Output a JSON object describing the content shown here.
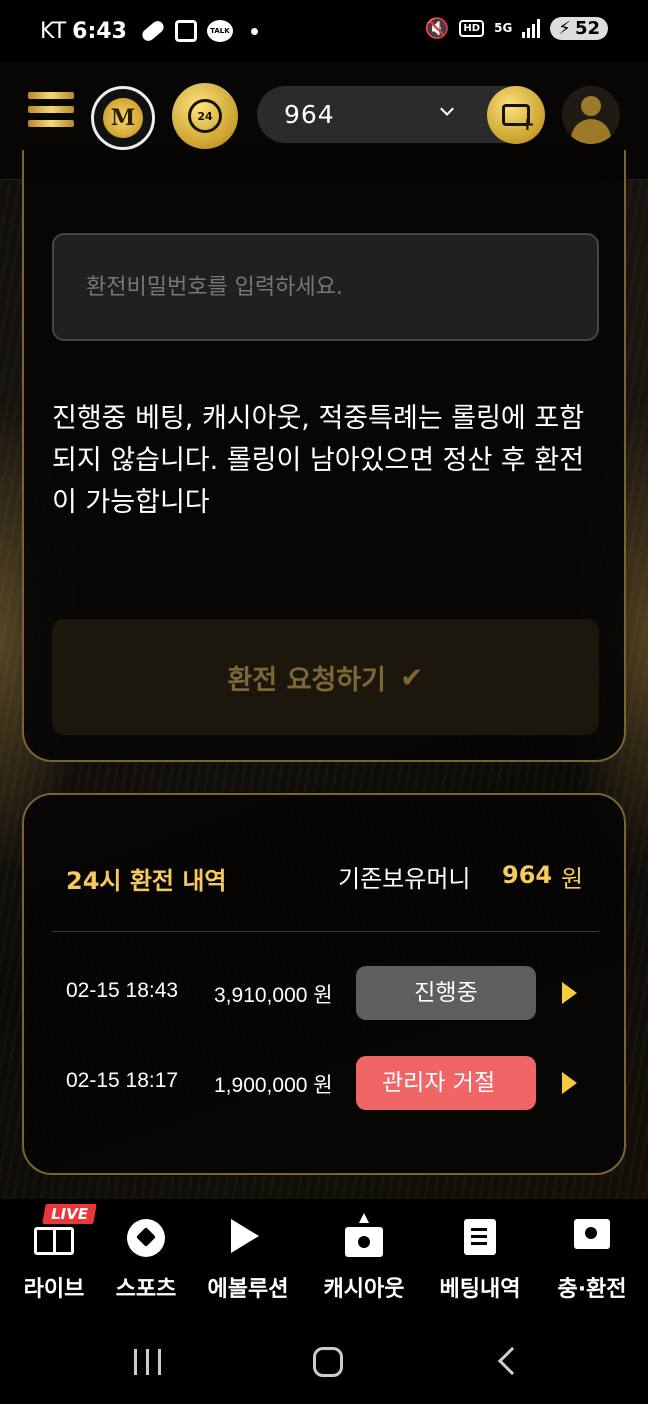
{
  "status_bar": {
    "carrier": "KT",
    "time": "6:43",
    "talk_label": "TALK",
    "hd_label": "HD",
    "network_label": "5G",
    "battery": "52"
  },
  "header": {
    "logo_letter": "M",
    "support_label": "24",
    "balance": "964"
  },
  "withdraw_form": {
    "password_placeholder": "환전비밀번호를 입력하세요.",
    "notice": "진행중 베팅, 캐시아웃, 적중특례는 롤링에 포함되지 않습니다. 롤링이 남아있으면 정산 후 환전이 가능합니다",
    "request_button_label": "환전 요청하기"
  },
  "history": {
    "title": "24시 환전 내역",
    "holding_label": "기존보유머니",
    "holding_value": "964",
    "holding_unit": "원",
    "rows": [
      {
        "datetime": "02-15 18:43",
        "amount": "3,910,000 원",
        "status": "진행중"
      },
      {
        "datetime": "02-15 18:17",
        "amount": "1,900,000 원",
        "status": "관리자 거절"
      }
    ]
  },
  "bottom_nav": {
    "live_badge": "LIVE",
    "items": [
      {
        "label": "라이브",
        "icon": "field-icon"
      },
      {
        "label": "스포츠",
        "icon": "soccer-ball-icon"
      },
      {
        "label": "에볼루션",
        "icon": "evolution-icon"
      },
      {
        "label": "캐시아웃",
        "icon": "cashout-icon"
      },
      {
        "label": "베팅내역",
        "icon": "document-icon"
      },
      {
        "label": "충·환전",
        "icon": "exchange-icon"
      }
    ]
  },
  "colors": {
    "accent_gold": "#f4cb5c",
    "pending": "#5e5e5e",
    "rejected": "#f06666",
    "live": "#e8383a"
  }
}
